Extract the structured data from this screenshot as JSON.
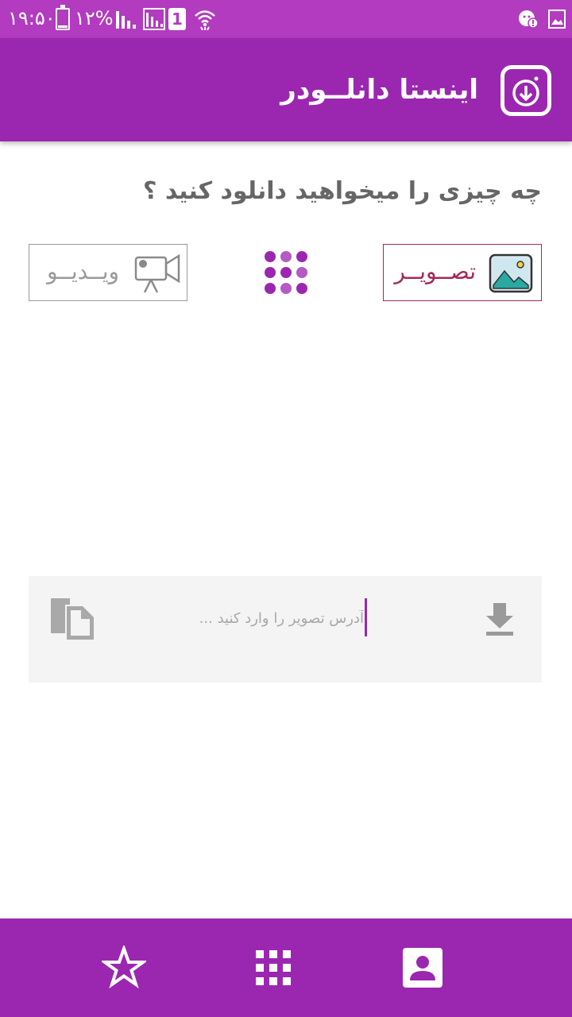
{
  "status_bar": {
    "time": "۱۹:۵۰",
    "battery_percent": "۱۲%",
    "battery_level": 0.12,
    "sim_slot": "1"
  },
  "app_bar": {
    "title": "اینستا دانلــودر",
    "logo_icon": "download-box-icon"
  },
  "main": {
    "question": "چه چیزی را میخواهید دانلود کنید ؟",
    "options": {
      "image_label": "تصــویــر",
      "video_label": "ویــدیــو",
      "menu_icon": "dots-grid-icon"
    },
    "url_field": {
      "placeholder": "آدرس تصویر را وارد کنید ...",
      "value": "",
      "download_icon": "download-icon",
      "paste_icon": "paste-icon"
    }
  },
  "bottom_nav": {
    "items": [
      "star-icon",
      "grid-icon",
      "account-box-icon"
    ]
  },
  "colors": {
    "status_bar": "#b23bc0",
    "primary": "#9b27b0",
    "image_accent": "#a32a5a",
    "muted": "#9a9a9a",
    "panel": "#f4f4f4"
  }
}
